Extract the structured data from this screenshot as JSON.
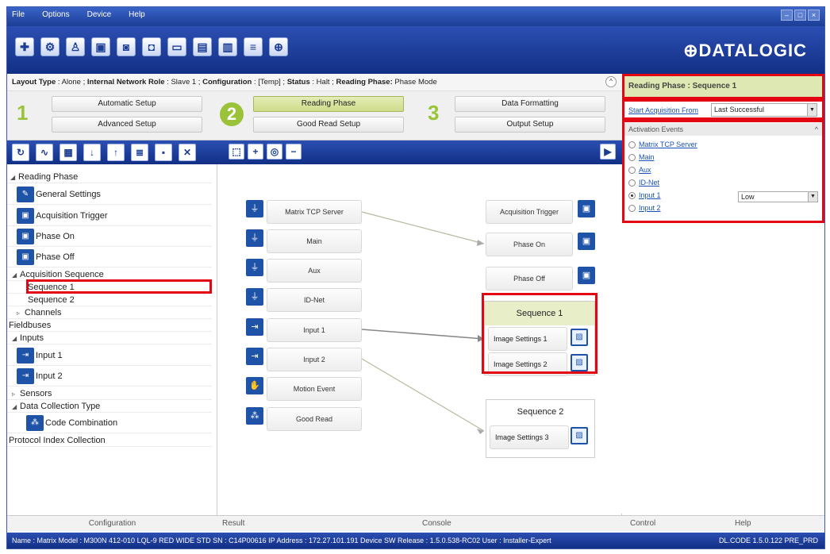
{
  "menu": [
    "File",
    "Options",
    "Device",
    "Help"
  ],
  "toolbar": {
    "icons": [
      "plus-icon",
      "settings-icon",
      "user-icon",
      "window-icon",
      "camera-icon",
      "camera-settings-icon",
      "monitor-icon",
      "monitor-camera-icon",
      "camera-list-icon",
      "network-icon",
      "crosshair-icon"
    ],
    "logo": "⊕DATALOGIC"
  },
  "statusline": {
    "layout_label": "Layout Type",
    "layout_value": ": Alone ;",
    "role_label": "Internal Network Role",
    "role_value": ": Slave 1 ;",
    "config_label": "Configuration",
    "config_value": ": [Temp] ;",
    "status_label": "Status",
    "status_value": ": Halt ;",
    "phase_label": "Reading Phase:",
    "phase_value": "Phase Mode"
  },
  "setup": {
    "step1": "1",
    "step2": "2",
    "step3": "3",
    "automatic": "Automatic Setup",
    "advanced": "Advanced Setup",
    "reading_phase": "Reading Phase",
    "good_read": "Good Read Setup",
    "data_formatting": "Data Formatting",
    "output_setup": "Output Setup"
  },
  "tree": {
    "reading_phase": "Reading Phase",
    "general_settings": "General Settings",
    "acquisition_trigger": "Acquisition Trigger",
    "phase_on": "Phase On",
    "phase_off": "Phase Off",
    "acquisition_sequence": "Acquisition Sequence",
    "sequence1": "Sequence 1",
    "sequence2": "Sequence 2",
    "channels": "Channels",
    "fieldbuses": "Fieldbuses",
    "inputs": "Inputs",
    "input1": "Input 1",
    "input2": "Input 2",
    "sensors": "Sensors",
    "data_collection_type": "Data Collection Type",
    "code_combination": "Code Combination",
    "protocol_index": "Protocol Index Collection"
  },
  "left_footer": "Configuration",
  "canvas": {
    "sources": [
      "Matrix TCP Server",
      "Main",
      "Aux",
      "ID-Net",
      "Input 1",
      "Input 2",
      "Motion Event",
      "Good Read"
    ],
    "acquisition_trigger": "Acquisition Trigger",
    "phase_on": "Phase On",
    "phase_off": "Phase Off",
    "seq1_title": "Sequence  1",
    "seq1_img1": "Image Settings  1",
    "seq1_img2": "Image Settings  2",
    "seq2_title": "Sequence  2",
    "seq2_img3": "Image Settings  3"
  },
  "center_footer": {
    "result": "Result",
    "console": "Console"
  },
  "right": {
    "header": "Reading Phase :  Sequence 1",
    "acq_label": "Start Acquisition From",
    "acq_value": "Last Successful",
    "events_head": "Activation Events",
    "events": [
      "Matrix TCP Server",
      "Main",
      "Aux",
      "ID-Net",
      "Input 1",
      "Input 2"
    ],
    "input1_value": "Low",
    "footer_control": "Control",
    "footer_help": "Help"
  },
  "bottom": {
    "info": "Name : Matrix   Model : M300N 412-010 LQL-9 RED WIDE STD   SN : C14P00616   IP Address :  172.27.101.191   Device SW Release : 1.5.0.538-RC02   User : Installer-Expert",
    "version": "DL.CODE 1.5.0.122 PRE_PRD"
  }
}
